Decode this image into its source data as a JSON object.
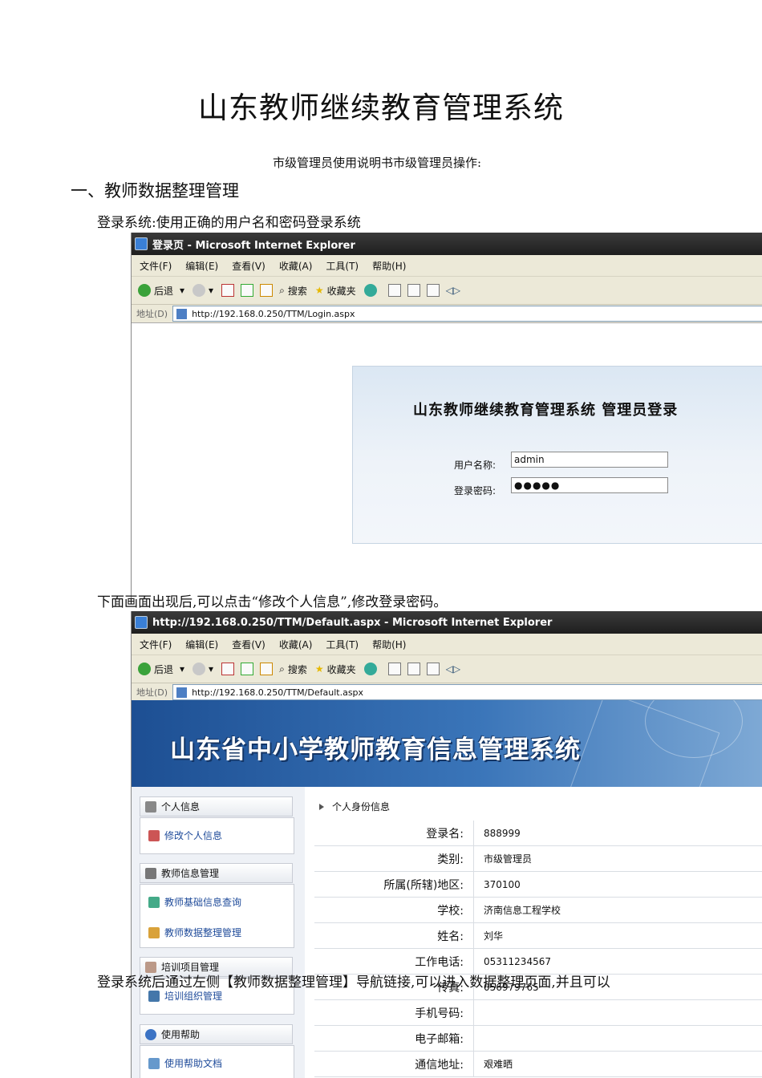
{
  "doc": {
    "title": "山东教师继续教育管理系统",
    "subtitle": "市级管理员使用说明书市级管理员操作:",
    "heading1": "一、教师数据整理管理",
    "para_login": "登录系统:使用正确的用户名和密码登录系统",
    "para_after": "下面画面出现后,可以点击“修改个人信息”,修改登录密码。",
    "para_nav": "登录系统后通过左侧【教师数据整理管理】导航链接,可以进入数据整理页面,并且可以"
  },
  "browser": {
    "menus": [
      "文件(F)",
      "编辑(E)",
      "查看(V)",
      "收藏(A)",
      "工具(T)",
      "帮助(H)"
    ],
    "toolbar": {
      "back": "后退",
      "search": "搜索",
      "favorites": "收藏夹"
    },
    "address_label": "地址(D)"
  },
  "window1": {
    "title": "登录页 - Microsoft Internet Explorer",
    "url": "http://192.168.0.250/TTM/Login.aspx",
    "login": {
      "title": "山东教师继续教育管理系统  管理员登录",
      "username_label": "用户名称:",
      "username_value": "admin",
      "password_label": "登录密码:",
      "password_value": "●●●●●"
    }
  },
  "window2": {
    "title": "http://192.168.0.250/TTM/Default.aspx - Microsoft Internet Explorer",
    "url": "http://192.168.0.250/TTM/Default.aspx",
    "banner_title": "山东省中小学教师教育信息管理系统",
    "sidebar": [
      {
        "head": "个人信息",
        "links": [
          "修改个人信息"
        ]
      },
      {
        "head": "教师信息管理",
        "links": [
          "教师基础信息查询",
          "教师数据整理管理"
        ]
      },
      {
        "head": "培训项目管理",
        "links": [
          "培训组织管理"
        ]
      },
      {
        "head": "使用帮助",
        "links": [
          "使用帮助文档"
        ]
      }
    ],
    "breadcrumb": "个人身份信息",
    "rows": [
      {
        "label": "登录名:",
        "value": "888999"
      },
      {
        "label": "类别:",
        "value": "市级管理员"
      },
      {
        "label": "所属(所辖)地区:",
        "value": "370100"
      },
      {
        "label": "学校:",
        "value": "济南信息工程学校"
      },
      {
        "label": "姓名:",
        "value": "刘华"
      },
      {
        "label": "工作电话:",
        "value": "05311234567"
      },
      {
        "label": "传真:",
        "value": "056979765"
      },
      {
        "label": "手机号码:",
        "value": ""
      },
      {
        "label": "电子邮箱:",
        "value": ""
      },
      {
        "label": "通信地址:",
        "value": "艰难晒"
      }
    ]
  }
}
